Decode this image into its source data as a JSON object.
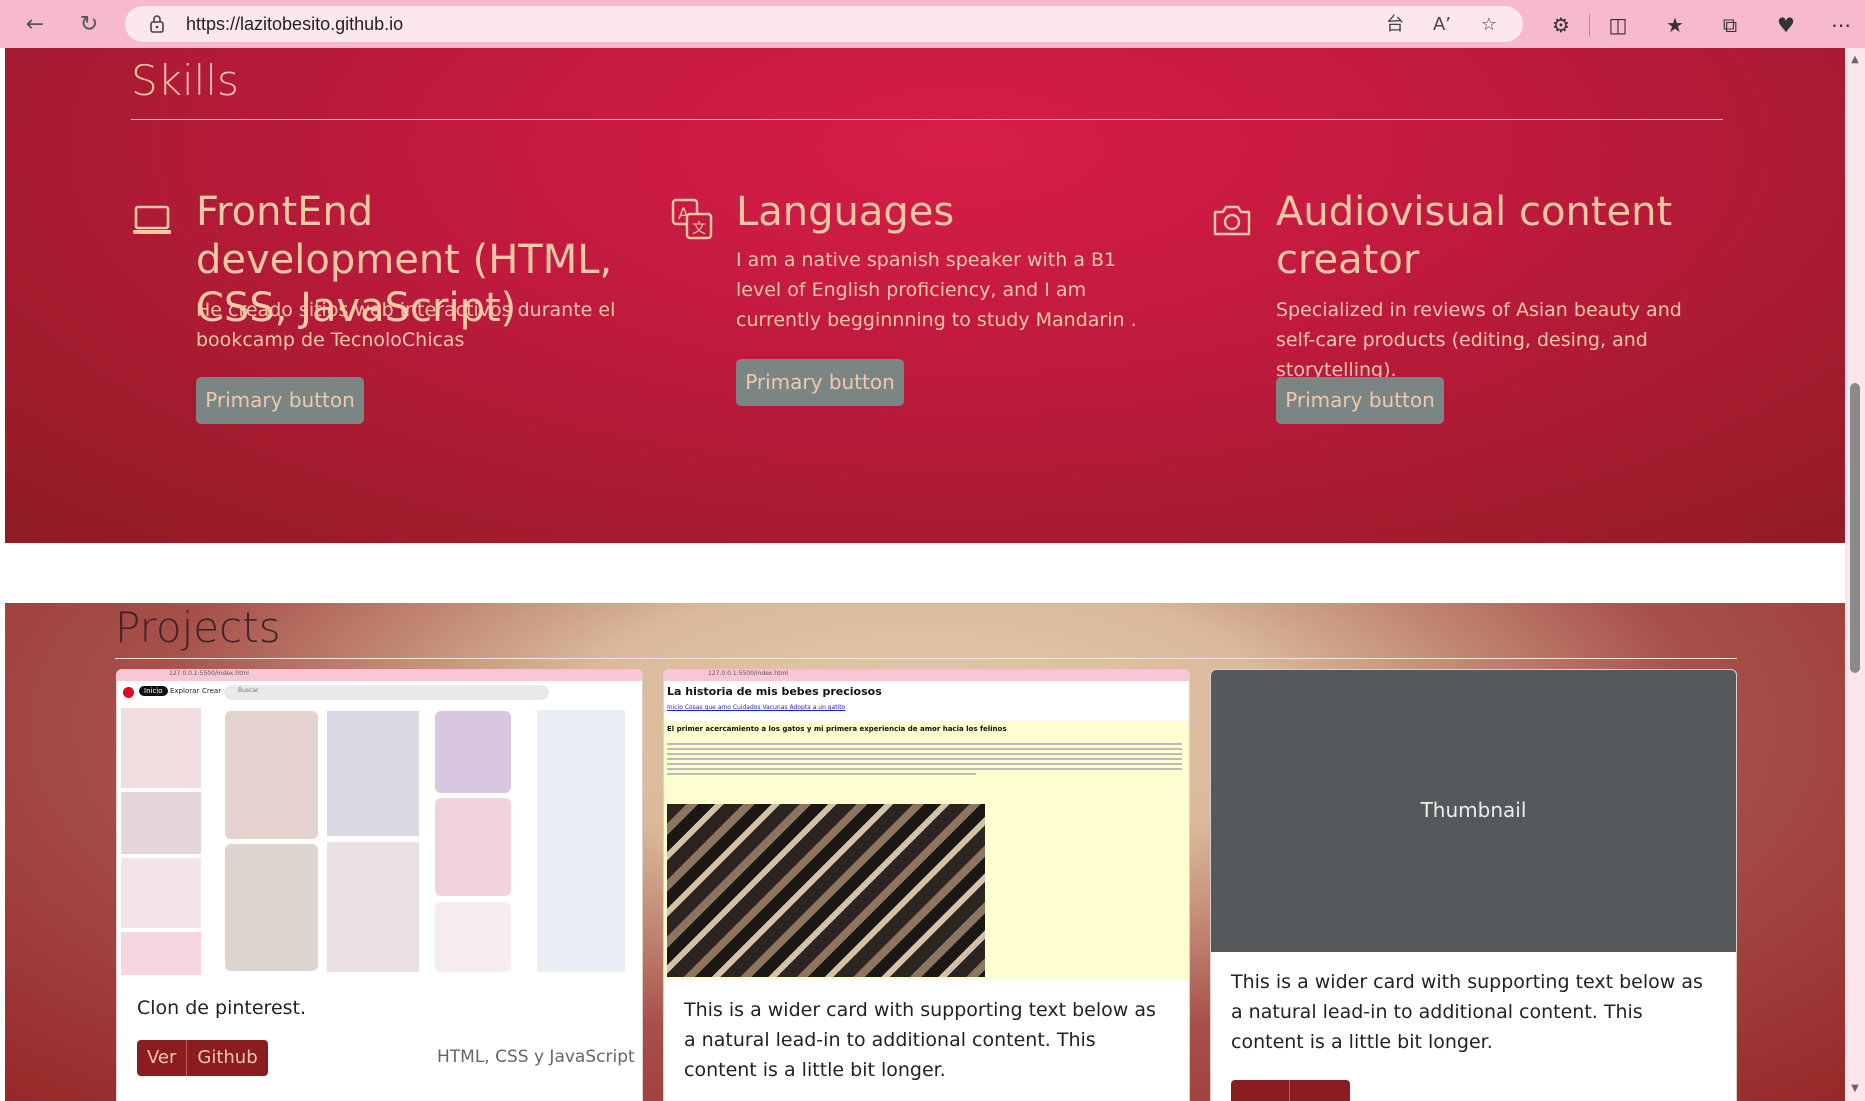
{
  "browser": {
    "url": "https://lazitobesito.github.io"
  },
  "skills": {
    "title": "Skills",
    "items": [
      {
        "title": "FrontEnd development (HTML, CSS, JavaScript)",
        "text": "He creado sitios web interactivos durante el bookcamp de TecnoloChicas",
        "button": "Primary button",
        "icon": "laptop-icon"
      },
      {
        "title": "Languages",
        "text": "I am a native spanish speaker with a B1 level of English proficiency, and I am currently begginnning to study Mandarin .",
        "button": "Primary button",
        "icon": "translate-icon"
      },
      {
        "title": "Audiovisual content creator",
        "text": "Specialized in reviews of Asian beauty and self-care products (editing, desing, and storytelling).",
        "button": "Primary button",
        "icon": "camera-icon"
      }
    ]
  },
  "projects": {
    "title": "Projects",
    "cards": [
      {
        "text": "Clon de pinterest.",
        "buttons": [
          "Ver",
          "Github"
        ],
        "tech": "HTML, CSS y JavaScript"
      },
      {
        "text": "This is a wider card with supporting text below as a natural lead-in to additional content. This content is a little bit longer.",
        "screenshot": {
          "url": "127.0.0.1:5500/index.html",
          "heading": "La historia de mis bebes preciosos",
          "links": [
            "Inicio",
            "Cosas que amo",
            "Cuidados",
            "Vacunas",
            "Adopta a un gatito"
          ],
          "subheading": "El primer acercamiento a los gatos y mi primera experiencia de amor hacia los felinos"
        }
      },
      {
        "text": "This is a wider card with supporting text below as a natural lead-in to additional content. This content is a little bit longer.",
        "thumb": "Thumbnail"
      }
    ],
    "pinterest": {
      "url": "127.0.0.1:5500/index.html",
      "nav": [
        "Inicio",
        "Explorar",
        "Crear"
      ],
      "search": "Buscar"
    }
  },
  "colors": {
    "skills_bg": "#c01a3e",
    "skills_text": "#f2c9a5",
    "button_gray": "#7a8584",
    "button_red": "#8b1c1f",
    "browser_chrome": "#f7b9cd"
  }
}
